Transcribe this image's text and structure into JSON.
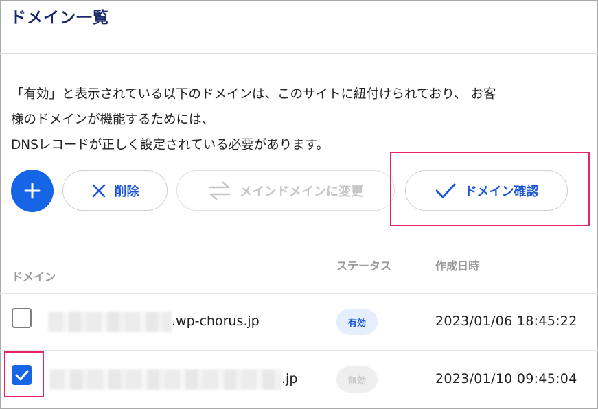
{
  "page": {
    "title": "ドメイン一覧"
  },
  "description": {
    "lines": [
      "「有効」と表示されている以下のドメインは、このサイトに紐付けられており、 お客",
      "様のドメインが機能するためには、",
      "DNSレコードが正しく設定されている必要があります。"
    ]
  },
  "toolbar": {
    "add_icon": "plus-icon",
    "delete_label": "削除",
    "delete_icon": "close-icon",
    "change_main_label": "メインドメインに変更",
    "change_main_icon": "swap-icon",
    "change_main_enabled": false,
    "verify_label": "ドメイン確認",
    "verify_icon": "check-icon"
  },
  "table": {
    "headers": {
      "domain": "ドメイン",
      "status": "ステータス",
      "created": "作成日時"
    },
    "rows": [
      {
        "domain_suffix": ".wp-chorus.jp",
        "status": "有効",
        "created": "2023/01/06 18:45:22",
        "checked": false
      },
      {
        "domain_suffix": ".jp",
        "status": "無効",
        "created": "2023/01/10 09:45:04",
        "checked": true
      }
    ]
  },
  "colors": {
    "primary": "#1565e6",
    "highlight": "#e62569",
    "title": "#1b2a6b"
  }
}
